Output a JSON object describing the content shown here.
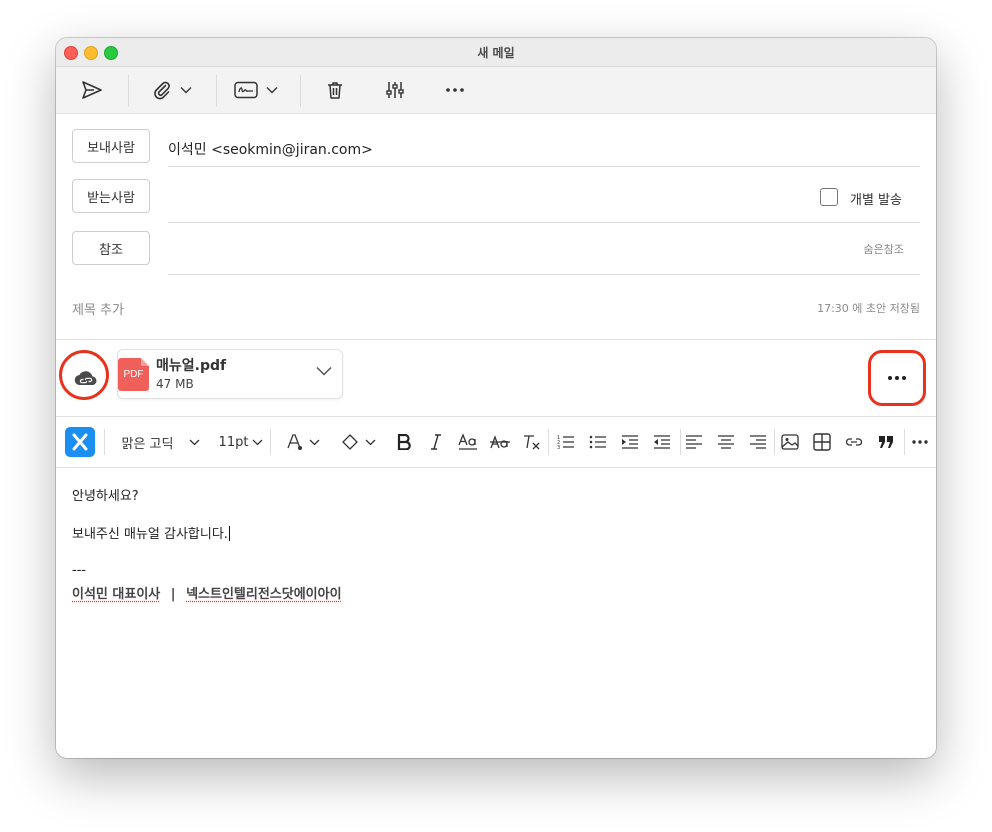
{
  "window": {
    "title": "새 메일"
  },
  "toolbar": {
    "send_icon": "send-icon",
    "attach_icon": "paperclip-icon",
    "signature_icon": "signature-icon",
    "delete_icon": "trash-icon",
    "options_icon": "sliders-icon",
    "more_icon": "more-horizontal-icon"
  },
  "header": {
    "from_button": "보내사람",
    "from_value": "이석민 <seokmin@jiran.com>",
    "to_button": "받는사람",
    "individual_send_label": "개별 발송",
    "individual_send_checked": false,
    "cc_button": "참조",
    "bcc_link": "숨은참조",
    "subject_placeholder": "제목 추가",
    "saved_status": "17:30 에 초안 저장됨"
  },
  "attachment": {
    "cloud_icon": "cloud-link-icon",
    "file_type": "PDF",
    "file_name": "매뉴얼.pdf",
    "file_size": "47 MB",
    "more_icon": "more-horizontal-icon"
  },
  "format_toolbar": {
    "font_family": "맑은 고딕",
    "font_size": "11pt",
    "accent": "#1b8ef2"
  },
  "body": {
    "greeting": "안녕하세요?",
    "message": "보내주신 매뉴얼 감사합니다.",
    "sig_separator": "---",
    "sig_name_title": "이석민 대표이사",
    "sig_divider": "|",
    "sig_company": "넥스트인텔리전스닷에이아이"
  },
  "colors": {
    "highlight": "#e8321e",
    "pdf": "#f0605a"
  }
}
